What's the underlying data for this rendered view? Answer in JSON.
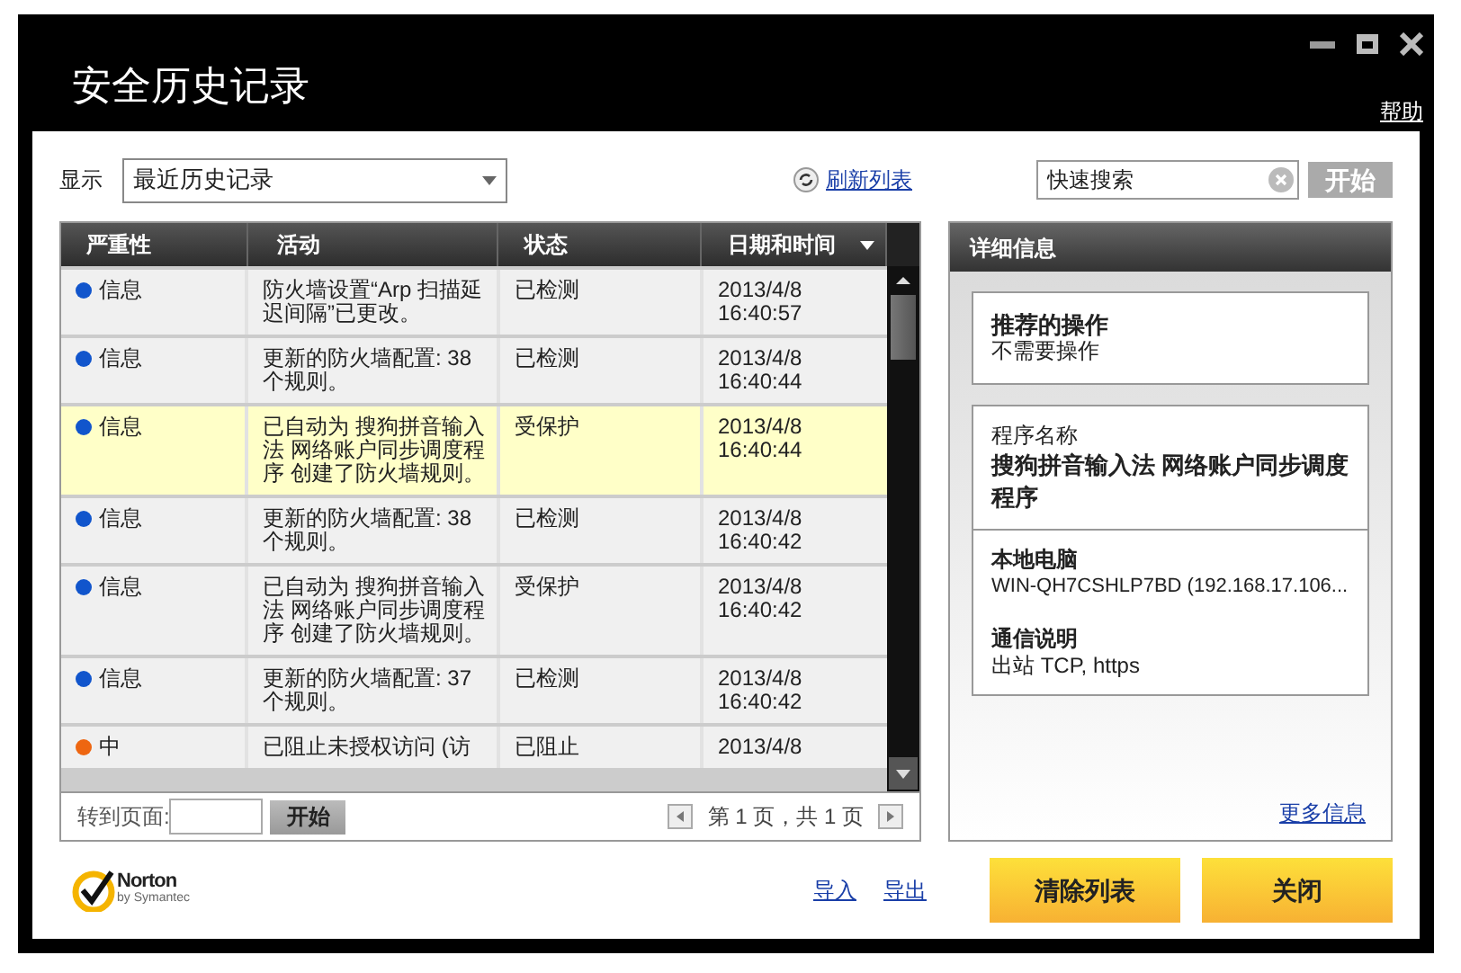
{
  "window": {
    "title": "安全历史记录",
    "help": "帮助"
  },
  "toolbar": {
    "show_label": "显示",
    "view": "最近历史记录",
    "refresh": "刷新列表",
    "search_placeholder": "快速搜索",
    "search_button": "开始"
  },
  "table": {
    "columns": [
      {
        "label": "严重性",
        "sorted": false
      },
      {
        "label": "活动",
        "sorted": false
      },
      {
        "label": "状态",
        "sorted": false
      },
      {
        "label": "日期和时间",
        "sorted": true
      }
    ],
    "rows": [
      {
        "severity": "信息",
        "color": "#1155cc",
        "activity": "防火墙设置“Arp 扫描延迟间隔”已更改。",
        "status": "已检测",
        "date": "2013/4/8",
        "time": "16:40:57",
        "selected": false
      },
      {
        "severity": "信息",
        "color": "#1155cc",
        "activity": "更新的防火墙配置: 38 个规则。",
        "status": "已检测",
        "date": "2013/4/8",
        "time": "16:40:44",
        "selected": false
      },
      {
        "severity": "信息",
        "color": "#1155cc",
        "activity": "已自动为 搜狗拼音输入法 网络账户同步调度程序 创建了防火墙规则。",
        "status": "受保护",
        "date": "2013/4/8",
        "time": "16:40:44",
        "selected": true
      },
      {
        "severity": "信息",
        "color": "#1155cc",
        "activity": "更新的防火墙配置: 38 个规则。",
        "status": "已检测",
        "date": "2013/4/8",
        "time": "16:40:42",
        "selected": false
      },
      {
        "severity": "信息",
        "color": "#1155cc",
        "activity": "已自动为 搜狗拼音输入法 网络账户同步调度程序 创建了防火墙规则。",
        "status": "受保护",
        "date": "2013/4/8",
        "time": "16:40:42",
        "selected": false
      },
      {
        "severity": "信息",
        "color": "#1155cc",
        "activity": "更新的防火墙配置: 37 个规则。",
        "status": "已检测",
        "date": "2013/4/8",
        "time": "16:40:42",
        "selected": false
      },
      {
        "severity": "中",
        "color": "#ee6611",
        "activity": "已阻止未授权访问 (访",
        "status": "已阻止",
        "date": "2013/4/8",
        "selected": false
      }
    ]
  },
  "pager": {
    "goto_label": "转到页面:",
    "go_button": "开始",
    "page_text": "第 1 页，共 1 页"
  },
  "details": {
    "title": "详细信息",
    "recommended_title": "推荐的操作",
    "recommended_value": "不需要操作",
    "program_label": "程序名称",
    "program_name": "搜狗拼音输入法 网络账户同步调度程序",
    "local_label": "本地电脑",
    "local_value": "WIN-QH7CSHLP7BD (192.168.17.106...",
    "comm_label": "通信说明",
    "comm_value": "出站 TCP, https",
    "more": "更多信息"
  },
  "footer": {
    "brand": "Norton",
    "brand_sub": "by Symantec",
    "links": [
      "导入",
      "导出"
    ],
    "buttons": [
      "清除列表",
      "关闭"
    ]
  }
}
